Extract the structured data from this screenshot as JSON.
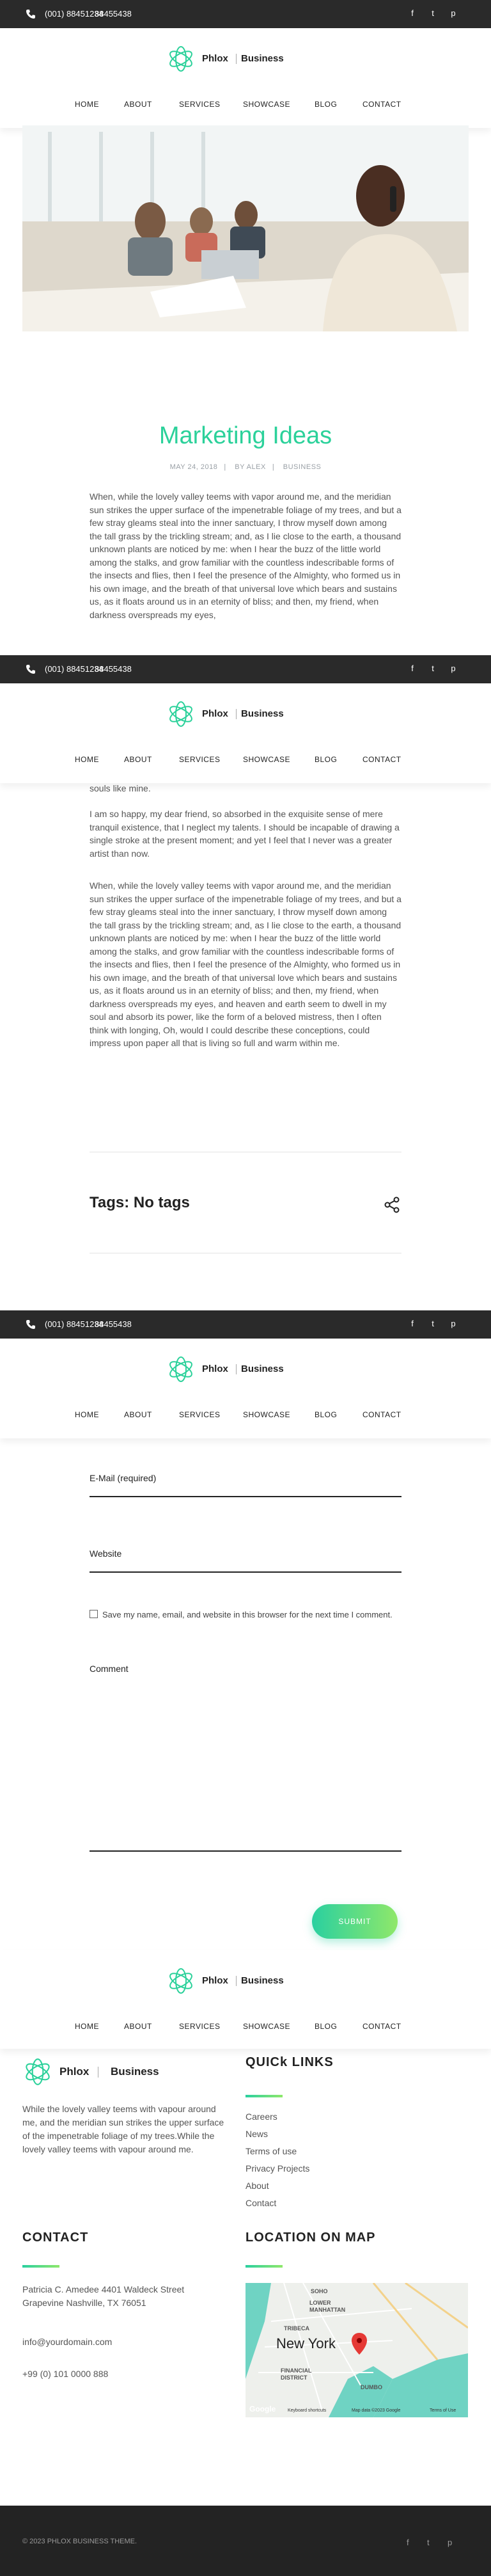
{
  "topbar": {
    "phone1": "(001) 88451234",
    "phone2": "88455438",
    "social": [
      "facebook-icon",
      "twitter-icon",
      "pinterest-icon"
    ]
  },
  "brand": {
    "name1": "Phlox",
    "name2": "Business"
  },
  "nav": [
    "HOME",
    "ABOUT",
    "SERVICES",
    "SHOWCASE",
    "BLOG",
    "CONTACT"
  ],
  "post": {
    "title": "Marketing Ideas",
    "date": "MAY 24, 2018",
    "author": "BY ALEX",
    "category": "BUSINESS",
    "p1": "When, while the lovely valley teems with vapor around me, and the meridian sun strikes the upper surface of the impenetrable foliage of my trees, and but a few stray gleams steal into the inner sanctuary, I throw myself down among the tall grass by the trickling stream; and, as I lie close to the earth, a thousand unknown plants are noticed by me: when I hear the buzz of the little world among the stalks, and grow familiar with the countless indescribable forms of the insects and flies, then I feel the presence of the Almighty, who formed us in his own image, and the breath of that universal love which bears and sustains us, as it floats around us in an eternity of bliss; and then, my friend, when darkness overspreads my eyes,",
    "p1_tail": "souls like mine.",
    "p2": "I am so happy, my dear friend, so absorbed in the exquisite sense of mere tranquil existence, that I neglect my talents. I should be incapable of drawing a single stroke at the present moment; and yet I feel that I never was a greater artist than now.",
    "p3": "When, while the lovely valley teems with vapor around me, and the meridian sun strikes the upper surface of the impenetrable foliage of my trees, and but a few stray gleams steal into the inner sanctuary, I throw myself down among the tall grass by the trickling stream; and, as I lie close to the earth, a thousand unknown plants are noticed by me: when I hear the buzz of the little world among the stalks, and grow familiar with the countless indescribable forms of the insects and flies, then I feel the presence of the Almighty, who formed us in his own image, and the breath of that universal love which bears and sustains us, as it floats around us in an eternity of bliss; and then, my friend, when darkness overspreads my eyes, and heaven and earth seem to dwell in my soul and absorb its power, like the form of a beloved mistress, then I often think with longing, Oh, would I could describe these conceptions, could impress upon paper all that is living so full and warm within me.",
    "tags": "Tags: No tags"
  },
  "form": {
    "email_label": "E-Mail (required)",
    "website_label": "Website",
    "save_text": "Save my name, email, and website in this browser for the next time I comment.",
    "comment_label": "Comment",
    "submit": "SUBMIT"
  },
  "footer": {
    "about": "While the lovely valley teems with vapour around me, and the meridian sun strikes the upper surface of the impenetrable foliage of my trees.While the lovely valley teems with vapour around me.",
    "quick_links_title": "QUICk LINKS",
    "links": [
      "Careers",
      "News",
      "Terms of use",
      "Privacy Projects",
      "About",
      "Contact"
    ],
    "contact_title": "CONTACT",
    "address": "Patricia C. Amedee 4401 Waldeck Street Grapevine Nashville, TX 76051",
    "email": "info@yourdomain.com",
    "phone": "+99 (0) 101 0000 888",
    "map_title": "LOCATION ON MAP",
    "map_labels": {
      "city": "New York",
      "soho": "SOHO",
      "lower": "LOWER MANHATTAN",
      "tribeca": "TRIBECA",
      "financial": "FINANCIAL DISTRICT",
      "dumbo": "DUMBO",
      "google": "Google",
      "shortcuts": "Keyboard shortcuts",
      "mapdata": "Map data ©2023 Google",
      "terms": "Terms of Use"
    },
    "copyright": "© 2023 PHLOX BUSINESS THEME."
  },
  "colors": {
    "accent": "#2bd19a",
    "accent2": "#8fe86a",
    "topbar": "#2a2a2a",
    "bottombar": "#232323"
  }
}
